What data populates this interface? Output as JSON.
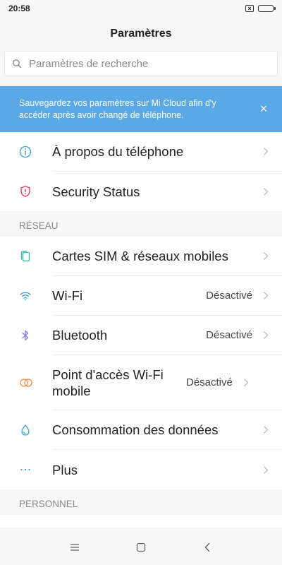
{
  "status": {
    "time": "20:58",
    "icons": [
      "sim-x-icon",
      "battery-icon"
    ],
    "battery_level": 1.0
  },
  "header": {
    "title": "Paramètres"
  },
  "search": {
    "placeholder": "Paramètres de recherche",
    "value": ""
  },
  "banner": {
    "text": "Sauvegardez vos paramètres sur Mi Cloud afin d'y accéder après avoir changé de téléphone.",
    "close_glyph": "×",
    "color": "#5aa9e6"
  },
  "top_group": [
    {
      "label": "À propos du téléphone",
      "icon": "info-icon",
      "icon_color": "#2aa3d9"
    },
    {
      "label": "Security Status",
      "icon": "shield-icon",
      "icon_color": "#e0335e"
    }
  ],
  "network": {
    "header": "RÉSEAU",
    "items": [
      {
        "label": "Cartes SIM & réseaux mobiles",
        "icon": "sim-cards-icon",
        "icon_color": "#2fb8a8",
        "value": ""
      },
      {
        "label": "Wi-Fi",
        "icon": "wifi-icon",
        "icon_color": "#2aa3d9",
        "value": "Désactivé"
      },
      {
        "label": "Bluetooth",
        "icon": "bluetooth-icon",
        "icon_color": "#8a78e6",
        "value": "Désactivé"
      },
      {
        "label": "Point d'accès Wi-Fi mobile",
        "icon": "hotspot-icon",
        "icon_color": "#f08c3a",
        "value": "Désactivé"
      },
      {
        "label": "Consommation des données",
        "icon": "data-usage-icon",
        "icon_color": "#2aa3d9",
        "value": ""
      },
      {
        "label": "Plus",
        "icon": "more-icon",
        "icon_color": "#2aa3d9",
        "value": ""
      }
    ]
  },
  "personal": {
    "header": "PERSONNEL"
  },
  "navbar": {
    "buttons": [
      "menu-icon",
      "home-icon",
      "back-icon"
    ]
  }
}
